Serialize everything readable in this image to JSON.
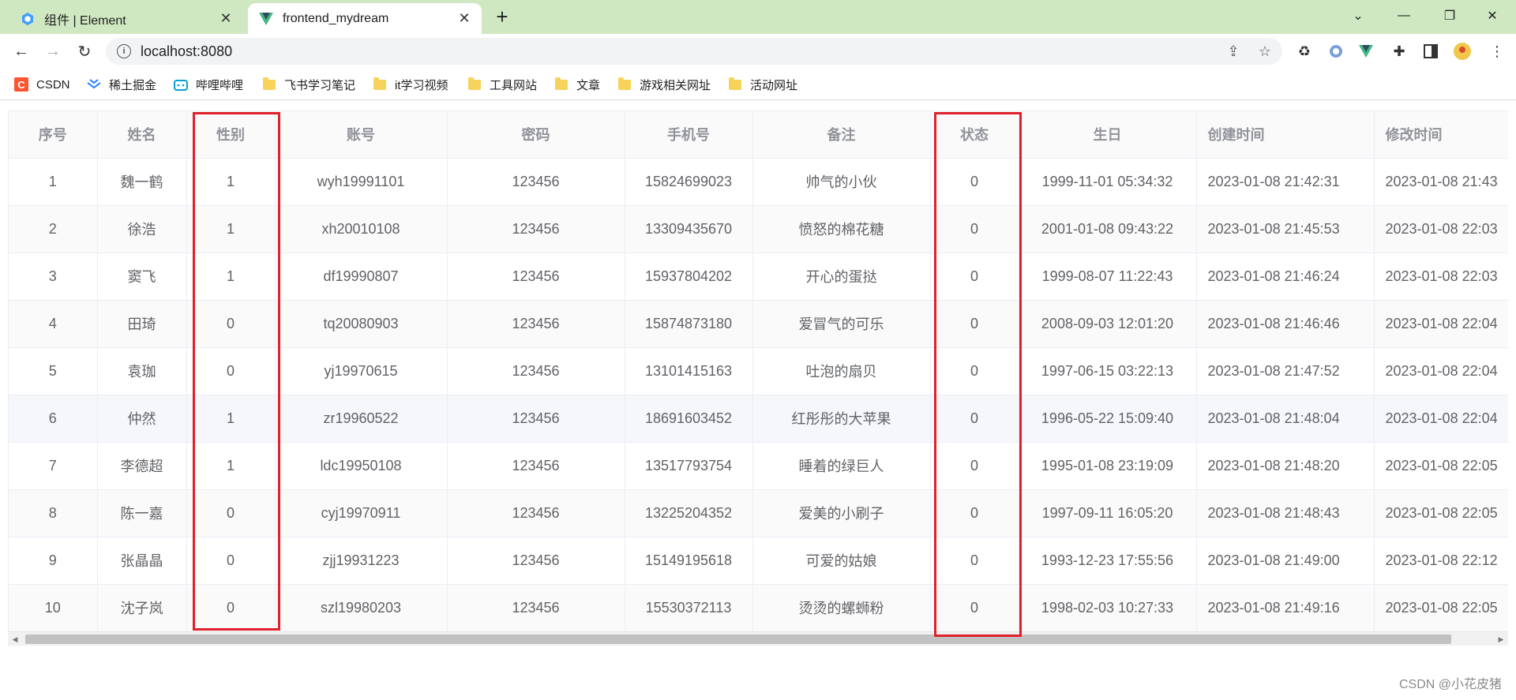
{
  "browser": {
    "tabs": [
      {
        "title": "组件 | Element",
        "active": false
      },
      {
        "title": "frontend_mydream",
        "active": true
      }
    ],
    "url": "localhost:8080",
    "bookmarks": [
      {
        "label": "CSDN",
        "icon": "csdn-icon"
      },
      {
        "label": "稀土掘金",
        "icon": "juejin-icon"
      },
      {
        "label": "哔哩哔哩",
        "icon": "bilibili-icon"
      },
      {
        "label": "飞书学习笔记",
        "icon": "folder-icon"
      },
      {
        "label": "it学习视频",
        "icon": "folder-icon"
      },
      {
        "label": "工具网站",
        "icon": "folder-icon"
      },
      {
        "label": "文章",
        "icon": "folder-icon"
      },
      {
        "label": "游戏相关网址",
        "icon": "folder-icon"
      },
      {
        "label": "活动网址",
        "icon": "folder-icon"
      }
    ]
  },
  "table": {
    "columns": [
      "序号",
      "姓名",
      "性别",
      "账号",
      "密码",
      "手机号",
      "备注",
      "状态",
      "生日",
      "创建时间",
      "修改时间"
    ],
    "rows": [
      [
        "1",
        "魏一鹤",
        "1",
        "wyh19991101",
        "123456",
        "15824699023",
        "帅气的小伙",
        "0",
        "1999-11-01 05:34:32",
        "2023-01-08 21:42:31",
        "2023-01-08 21:43"
      ],
      [
        "2",
        "徐浩",
        "1",
        "xh20010108",
        "123456",
        "13309435670",
        "愤怒的棉花糖",
        "0",
        "2001-01-08 09:43:22",
        "2023-01-08 21:45:53",
        "2023-01-08 22:03"
      ],
      [
        "3",
        "窦飞",
        "1",
        "df19990807",
        "123456",
        "15937804202",
        "开心的蛋挞",
        "0",
        "1999-08-07 11:22:43",
        "2023-01-08 21:46:24",
        "2023-01-08 22:03"
      ],
      [
        "4",
        "田琦",
        "0",
        "tq20080903",
        "123456",
        "15874873180",
        "爱冒气的可乐",
        "0",
        "2008-09-03 12:01:20",
        "2023-01-08 21:46:46",
        "2023-01-08 22:04"
      ],
      [
        "5",
        "袁珈",
        "0",
        "yj19970615",
        "123456",
        "13101415163",
        "吐泡的扇贝",
        "0",
        "1997-06-15 03:22:13",
        "2023-01-08 21:47:52",
        "2023-01-08 22:04"
      ],
      [
        "6",
        "仲然",
        "1",
        "zr19960522",
        "123456",
        "18691603452",
        "红彤彤的大苹果",
        "0",
        "1996-05-22 15:09:40",
        "2023-01-08 21:48:04",
        "2023-01-08 22:04"
      ],
      [
        "7",
        "李德超",
        "1",
        "ldc19950108",
        "123456",
        "13517793754",
        "睡着的绿巨人",
        "0",
        "1995-01-08 23:19:09",
        "2023-01-08 21:48:20",
        "2023-01-08 22:05"
      ],
      [
        "8",
        "陈一嘉",
        "0",
        "cyj19970911",
        "123456",
        "13225204352",
        "爱美的小刷子",
        "0",
        "1997-09-11 16:05:20",
        "2023-01-08 21:48:43",
        "2023-01-08 22:05"
      ],
      [
        "9",
        "张晶晶",
        "0",
        "zjj19931223",
        "123456",
        "15149195618",
        "可爱的姑娘",
        "0",
        "1993-12-23 17:55:56",
        "2023-01-08 21:49:00",
        "2023-01-08 22:12"
      ],
      [
        "10",
        "沈子岚",
        "0",
        "szl19980203",
        "123456",
        "15530372113",
        "烫烫的螺蛳粉",
        "0",
        "1998-02-03 10:27:33",
        "2023-01-08 21:49:16",
        "2023-01-08 22:05"
      ]
    ]
  },
  "watermark": "CSDN @小花皮猪",
  "colors": {
    "highlight": "#e0202a",
    "header_text": "#909399",
    "cell_text": "#606266"
  }
}
